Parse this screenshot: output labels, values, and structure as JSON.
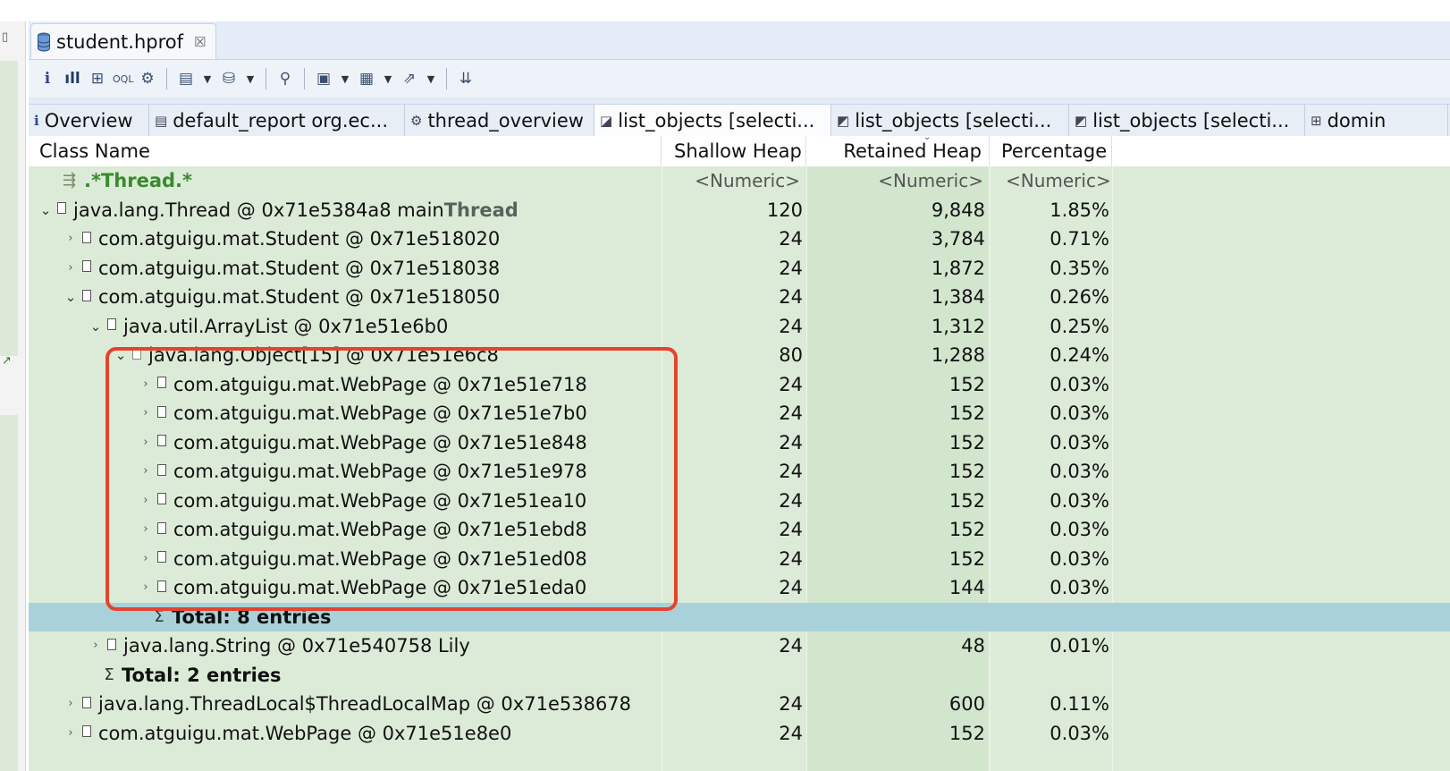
{
  "file_tab": {
    "label": "student.hprof",
    "close_symbol": "☒"
  },
  "toolbar": {
    "icons": [
      "info-icon",
      "histogram-icon",
      "dominator-tree-icon",
      "oql-icon",
      "thread-overview-icon",
      "run-report-icon",
      "dropdown-arrow-icon",
      "query-browser-icon",
      "dropdown-arrow-icon",
      "search-icon",
      "group-by-icon",
      "dropdown-arrow-icon",
      "calculate-icon",
      "dropdown-arrow-icon",
      "export-icon",
      "dropdown-arrow-icon",
      "pin-icon"
    ]
  },
  "subtabs": [
    {
      "label": "Overview",
      "icon": "info-icon"
    },
    {
      "label": "default_report  org.ec...",
      "icon": "report-icon"
    },
    {
      "label": "thread_overview",
      "icon": "gear-icon"
    },
    {
      "label": "list_objects  [selecti...",
      "icon": "list-objects-icon"
    },
    {
      "label": "list_objects  [selecti...",
      "icon": "list-objects-icon"
    },
    {
      "label": "list_objects  [selecti...",
      "icon": "list-objects-icon"
    },
    {
      "label": "domin",
      "icon": "dominator-tree-icon"
    }
  ],
  "table": {
    "columns": [
      "Class Name",
      "Shallow Heap",
      "Retained Heap",
      "Percentage"
    ],
    "sort_indicator": "⌄",
    "filter_row": {
      "name": ".*Thread.*",
      "shallow": "<Numeric>",
      "retained": "<Numeric>",
      "percentage": "<Numeric>"
    },
    "rows": [
      {
        "level": 0,
        "twisty": "open",
        "name": "java.lang.Thread @ 0x71e5384a8  main",
        "suffix": "Thread",
        "shallow": "120",
        "retained": "9,848",
        "percentage": "1.85%"
      },
      {
        "level": 1,
        "twisty": "closed",
        "name": "com.atguigu.mat.Student @ 0x71e518020",
        "suffix": "",
        "shallow": "24",
        "retained": "3,784",
        "percentage": "0.71%"
      },
      {
        "level": 1,
        "twisty": "closed",
        "name": "com.atguigu.mat.Student @ 0x71e518038",
        "suffix": "",
        "shallow": "24",
        "retained": "1,872",
        "percentage": "0.35%"
      },
      {
        "level": 1,
        "twisty": "open",
        "name": "com.atguigu.mat.Student @ 0x71e518050",
        "suffix": "",
        "shallow": "24",
        "retained": "1,384",
        "percentage": "0.26%"
      },
      {
        "level": 2,
        "twisty": "open",
        "name": "java.util.ArrayList @ 0x71e51e6b0",
        "suffix": "",
        "shallow": "24",
        "retained": "1,312",
        "percentage": "0.25%"
      },
      {
        "level": 3,
        "twisty": "open",
        "name": "java.lang.Object[15] @ 0x71e51e6c8",
        "suffix": "",
        "shallow": "80",
        "retained": "1,288",
        "percentage": "0.24%"
      },
      {
        "level": 4,
        "twisty": "closed",
        "name": "com.atguigu.mat.WebPage @ 0x71e51e718",
        "suffix": "",
        "shallow": "24",
        "retained": "152",
        "percentage": "0.03%"
      },
      {
        "level": 4,
        "twisty": "closed",
        "name": "com.atguigu.mat.WebPage @ 0x71e51e7b0",
        "suffix": "",
        "shallow": "24",
        "retained": "152",
        "percentage": "0.03%"
      },
      {
        "level": 4,
        "twisty": "closed",
        "name": "com.atguigu.mat.WebPage @ 0x71e51e848",
        "suffix": "",
        "shallow": "24",
        "retained": "152",
        "percentage": "0.03%"
      },
      {
        "level": 4,
        "twisty": "closed",
        "name": "com.atguigu.mat.WebPage @ 0x71e51e978",
        "suffix": "",
        "shallow": "24",
        "retained": "152",
        "percentage": "0.03%"
      },
      {
        "level": 4,
        "twisty": "closed",
        "name": "com.atguigu.mat.WebPage @ 0x71e51ea10",
        "suffix": "",
        "shallow": "24",
        "retained": "152",
        "percentage": "0.03%"
      },
      {
        "level": 4,
        "twisty": "closed",
        "name": "com.atguigu.mat.WebPage @ 0x71e51ebd8",
        "suffix": "",
        "shallow": "24",
        "retained": "152",
        "percentage": "0.03%"
      },
      {
        "level": 4,
        "twisty": "closed",
        "name": "com.atguigu.mat.WebPage @ 0x71e51ed08",
        "suffix": "",
        "shallow": "24",
        "retained": "152",
        "percentage": "0.03%"
      },
      {
        "level": 4,
        "twisty": "closed",
        "name": "com.atguigu.mat.WebPage @ 0x71e51eda0",
        "suffix": "",
        "shallow": "24",
        "retained": "144",
        "percentage": "0.03%"
      },
      {
        "level": 4,
        "total": true,
        "selected": true,
        "name": "Total: 8 entries",
        "shallow": "",
        "retained": "",
        "percentage": ""
      },
      {
        "level": 2,
        "twisty": "closed",
        "name": "java.lang.String @ 0x71e540758  Lily",
        "suffix": "",
        "shallow": "24",
        "retained": "48",
        "percentage": "0.01%"
      },
      {
        "level": 2,
        "total": true,
        "name": "Total: 2 entries",
        "shallow": "",
        "retained": "",
        "percentage": ""
      },
      {
        "level": 1,
        "twisty": "closed",
        "name": "java.lang.ThreadLocal$ThreadLocalMap @ 0x71e538678",
        "suffix": "",
        "shallow": "24",
        "retained": "600",
        "percentage": "0.11%"
      },
      {
        "level": 1,
        "twisty": "closed",
        "name": "com.atguigu.mat.WebPage @ 0x71e51e8e0",
        "suffix": "",
        "shallow": "24",
        "retained": "152",
        "percentage": "0.03%"
      }
    ]
  },
  "colors": {
    "table_bg": "#dcebd8",
    "selected_row": "#a9d1d9",
    "highlight_border": "#e5432e",
    "filter_text": "#3a8a2e"
  }
}
